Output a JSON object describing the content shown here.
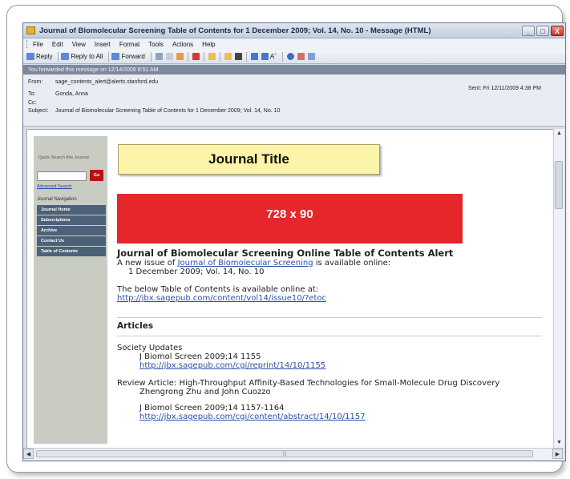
{
  "window": {
    "title": "Journal of Biomolecular Screening Table of Contents for 1 December 2009; Vol. 14, No. 10 - Message (HTML)",
    "controls": {
      "minimize": "_",
      "maximize": "□",
      "close": "X"
    }
  },
  "menu": [
    "File",
    "Edit",
    "View",
    "Insert",
    "Format",
    "Tools",
    "Actions",
    "Help"
  ],
  "toolbar": {
    "reply": "Reply",
    "reply_all": "Reply to All",
    "forward": "Forward",
    "font_size_icon": "Aˆ"
  },
  "infobar": {
    "text": "You forwarded this message on 12/14/2009 8:51 AM."
  },
  "headers": {
    "from_label": "From:",
    "from_value": "sage_contents_alert@alerts.stanford.edu",
    "to_label": "To:",
    "to_value": "Gonda, Anna",
    "cc_label": "Cc:",
    "cc_value": "",
    "subject_label": "Subject:",
    "subject_value": "Journal of Biomolecular Screening Table of Contents for 1 December 2009; Vol. 14, No. 10",
    "sent_label": "Sent:",
    "sent_value": "Fri 12/11/2009 4:38 PM"
  },
  "sidebar": {
    "quick_search": "Quick Search this Journal",
    "go_button": "Go",
    "advanced_search": "Advanced Search",
    "nav_title": "Journal Navigation",
    "nav_items": [
      "Journal Home",
      "Subscriptions",
      "Archive",
      "Contact Us",
      "Table of Contents"
    ]
  },
  "journal_title_box": "Journal Title",
  "banner_ad": "728 x 90",
  "content": {
    "alert_title": "Journal of Biomolecular Screening Online Table of Contents Alert",
    "intro_prefix": "A new issue of ",
    "intro_link": "Journal of Biomolecular Screening",
    "intro_suffix": " is available online:",
    "issue": "1 December 2009; Vol. 14, No. 10",
    "toc_text": "The below Table of Contents is available online at:",
    "toc_link": "http://jbx.sagepub.com/content/vol14/issue10/?etoc",
    "articles_heading": "Articles",
    "articles": [
      {
        "title": "Society Updates",
        "authors": "",
        "citation": "J Biomol Screen 2009;14 1155",
        "link": "http://jbx.sagepub.com/cgi/reprint/14/10/1155"
      },
      {
        "title": "Review Article: High-Throughput Affinity-Based Technologies for Small-Molecule Drug Discovery",
        "authors": "Zhengrong Zhu and John Cuozzo",
        "citation": "J Biomol Screen 2009;14 1157-1164",
        "link": "http://jbx.sagepub.com/cgi/content/abstract/14/10/1157"
      }
    ]
  }
}
